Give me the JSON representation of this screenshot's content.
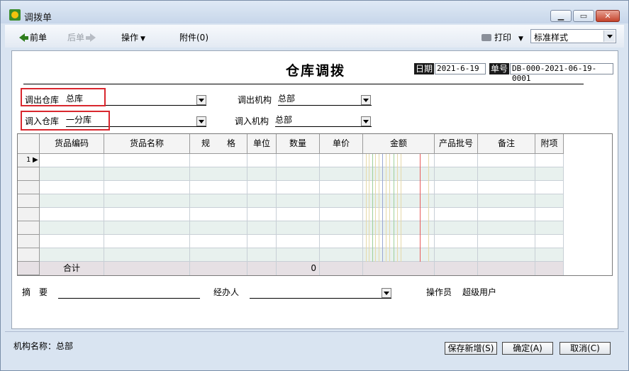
{
  "window": {
    "title": "调拨单"
  },
  "toolbar": {
    "prev": "前单",
    "next": "后单",
    "operations": "操作",
    "attachments": "附件(0)",
    "print": "打印",
    "print_style": "标准样式"
  },
  "document": {
    "title": "仓库调拨",
    "date_label": "日期",
    "date_value": "2021-6-19",
    "number_label": "单号",
    "number_value": "DB-000-2021-06-19-0001"
  },
  "fields": {
    "out_warehouse_label": "调出仓库",
    "out_warehouse_value": "总库",
    "out_org_label": "调出机构",
    "out_org_value": "总部",
    "in_warehouse_label": "调入仓库",
    "in_warehouse_value": "一分库",
    "in_org_label": "调入机构",
    "in_org_value": "总部"
  },
  "grid": {
    "columns": [
      "货品编码",
      "货品名称",
      "规　　格",
      "单位",
      "数量",
      "单价",
      "金额",
      "产品批号",
      "备注",
      "附项"
    ],
    "first_row_number": "1",
    "total_label": "合计",
    "total_quantity": "0"
  },
  "bottom": {
    "summary_label": "摘　要",
    "handler_label": "经办人",
    "operator_label": "操作员",
    "operator_value": "超级用户"
  },
  "footer": {
    "org_name": "机构名称：总部",
    "save_new": "保存新增(S)",
    "confirm": "确定(A)",
    "cancel": "取消(C)"
  },
  "colors": {
    "highlight_border": "#d9272e",
    "alt_row": "#e8f1ee"
  }
}
